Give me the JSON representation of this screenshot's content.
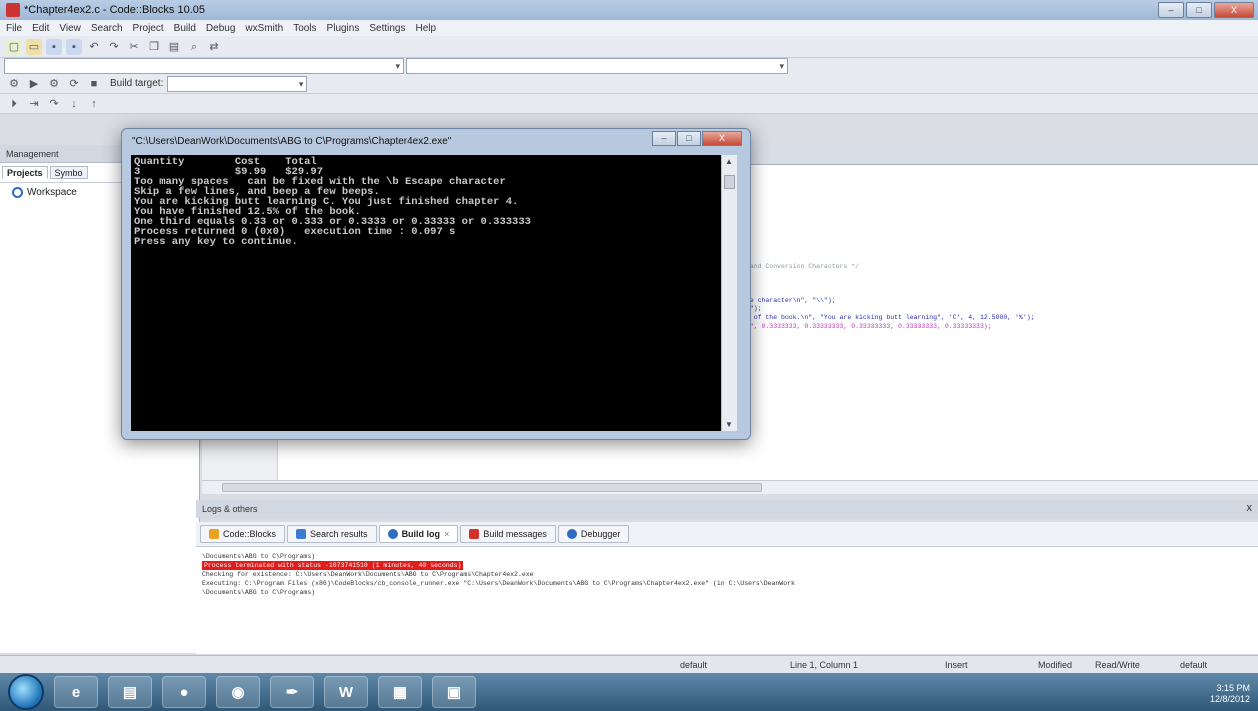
{
  "main_window": {
    "title": "*Chapter4ex2.c - Code::Blocks 10.05",
    "controls": [
      "–",
      "□",
      "X"
    ]
  },
  "menu": [
    "File",
    "Edit",
    "View",
    "Search",
    "Project",
    "Build",
    "Debug",
    "wxSmith",
    "Tools",
    "Plugins",
    "Settings",
    "Help"
  ],
  "toolbar": {
    "build_target_label": "Build target:",
    "build_target_value": ""
  },
  "management": {
    "header": "Management",
    "tabs": [
      "Projects",
      "Symbo"
    ],
    "workspace_label": "Workspace"
  },
  "editor": {
    "code_lines": [
      {
        "pre": "",
        "cmt": ", and Conversion Characters */"
      },
      {
        "pre": "ape character\\n\", \"\\\\\");",
        "cmt": ""
      },
      {
        "pre": "\\n\");",
        "cmt": ""
      },
      {
        "pre": "he of the book.\\n\", \"You are kicking butt learning\", 'C', 4, 12.5000, '%');",
        "cmt": ""
      },
      {
        "pre": "\\n\", 0.3333333, 0.33333333, 0.33333333, 0.33333333, 0.33333333);",
        "cmt": ""
      }
    ]
  },
  "console": {
    "title": "\"C:\\Users\\DeanWork\\Documents\\ABG to C\\Programs\\Chapter4ex2.exe\"",
    "lines": [
      "Quantity        Cost    Total",
      "3               $9.99   $29.97",
      "Too many spaces   can be fixed with the \\b Escape character",
      "",
      "",
      "",
      "Skip a few lines, and beep a few beeps.",
      "",
      "",
      "You are kicking butt learning C. You just finished chapter 4.",
      "You have finished 12.5% of the book.",
      "",
      "",
      "One third equals 0.33 or 0.333 or 0.3333 or 0.33333 or 0.333333",
      "",
      "",
      "",
      "Process returned 0 (0x0)   execution time : 0.097 s",
      "Press any key to continue."
    ]
  },
  "logs": {
    "header": "Logs & others",
    "close": "x",
    "tabs": [
      {
        "label": "Code::Blocks",
        "icon": "codeblocks-icon",
        "color": "#e7a21f"
      },
      {
        "label": "Search results",
        "icon": "search-icon",
        "color": "#3b7bd0"
      },
      {
        "label": "Build log",
        "icon": "build-log-icon",
        "color": "#2d6cc0"
      },
      {
        "label": "Build messages",
        "icon": "build-messages-icon",
        "color": "#d2312a"
      },
      {
        "label": "Debugger",
        "icon": "debugger-icon",
        "color": "#2d6cc0"
      }
    ],
    "lines": [
      "\\Documents\\ABG to C\\Programs)",
      "Process terminated with status -1073741510 (1 minutes, 40 seconds)",
      "",
      "Checking for existence: C:\\Users\\DeanWork\\Documents\\ABG to C\\Programs\\Chapter4ex2.exe",
      "Executing: C:\\Program Files (x86)\\CodeBlocks/cb_console_runner.exe \"C:\\Users\\DeanWork\\Documents\\ABG to C\\Programs\\Chapter4ex2.exe\" (in C:\\Users\\DeanWork",
      "\\Documents\\ABG to C\\Programs)"
    ]
  },
  "status": {
    "enc": "default",
    "position": "Line 1, Column 1",
    "mode": "Insert",
    "modified": "Modified",
    "rw": "Read/Write",
    "profile": "default"
  },
  "taskbar": {
    "apps": [
      "e",
      "▤",
      "●",
      "◉",
      "✒",
      "W",
      "▦",
      "▣"
    ],
    "time": "3:15 PM",
    "date": "12/8/2012"
  },
  "colors": {
    "error_bg": "#e21b1b",
    "console_bg": "#000000"
  }
}
